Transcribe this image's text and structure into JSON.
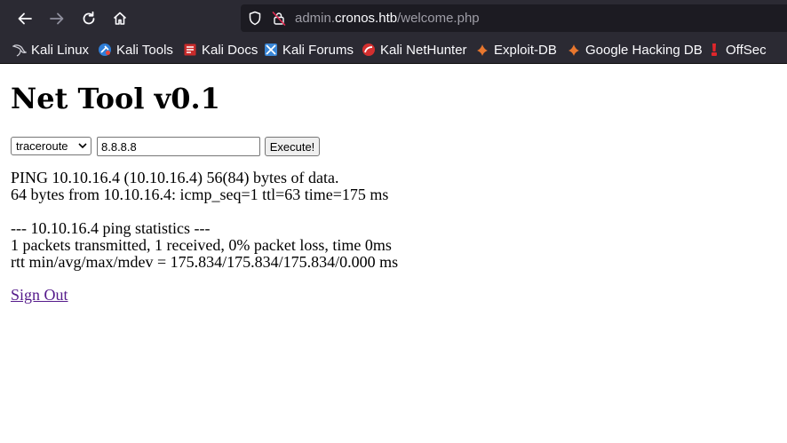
{
  "browser": {
    "url_prefix": "admin.",
    "url_host": "cronos.htb",
    "url_path": "/welcome.php",
    "bookmarks": [
      {
        "label": "Kali Linux",
        "icon": "kali-dragon-icon"
      },
      {
        "label": "Kali Tools",
        "icon": "kali-tools-icon"
      },
      {
        "label": "Kali Docs",
        "icon": "kali-docs-icon"
      },
      {
        "label": "Kali Forums",
        "icon": "kali-forums-icon"
      },
      {
        "label": "Kali NetHunter",
        "icon": "nethunter-icon"
      },
      {
        "label": "Exploit-DB",
        "icon": "exploit-db-icon"
      },
      {
        "label": "Google Hacking DB",
        "icon": "ghdb-icon"
      },
      {
        "label": "OffSec",
        "icon": "offsec-icon"
      }
    ]
  },
  "page": {
    "title": "Net Tool v0.1",
    "command_select": "traceroute",
    "host_input": "8.8.8.8",
    "execute_label": "Execute!",
    "output_lines": [
      "PING 10.10.16.4 (10.10.16.4) 56(84) bytes of data.",
      "64 bytes from 10.10.16.4: icmp_seq=1 ttl=63 time=175 ms",
      "",
      "--- 10.10.16.4 ping statistics ---",
      "1 packets transmitted, 1 received, 0% packet loss, time 0ms",
      "rtt min/avg/max/mdev = 175.834/175.834/175.834/0.000 ms"
    ],
    "signout_label": "Sign Out"
  }
}
